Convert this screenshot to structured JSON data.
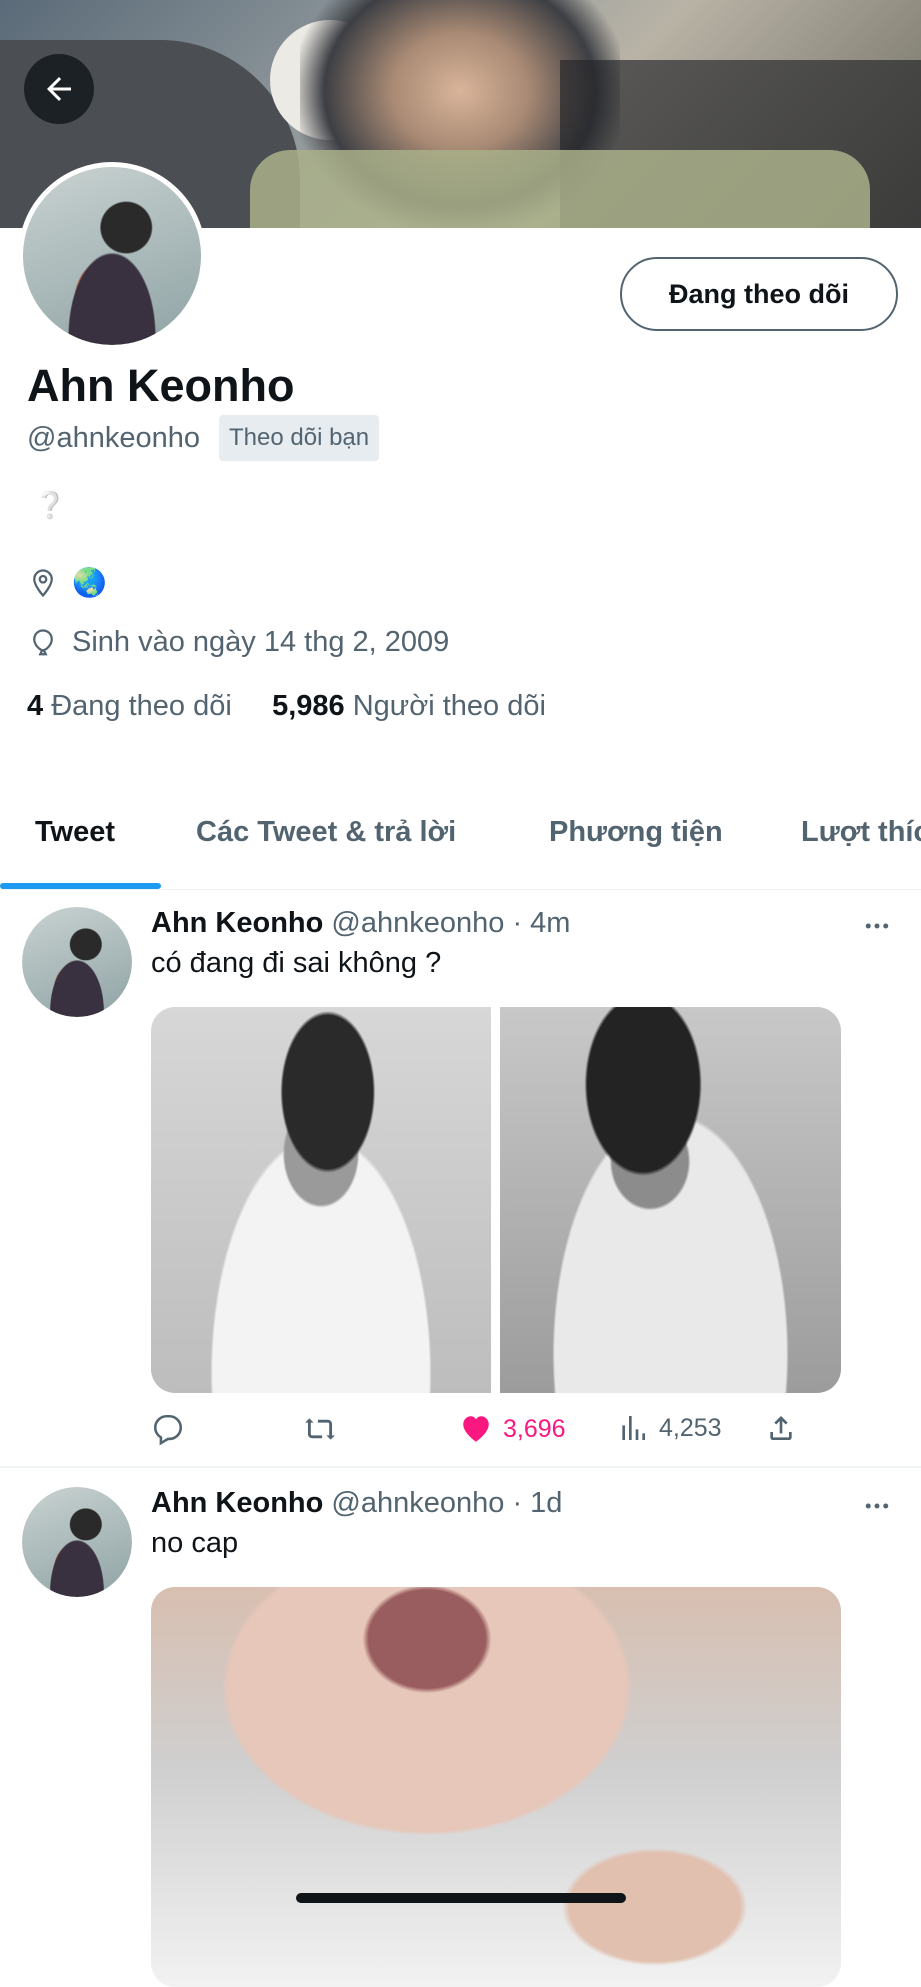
{
  "profile": {
    "follow_button": "Đang theo dõi",
    "name": "Ahn Keonho",
    "handle": "@ahnkeonho",
    "follows_you": "Theo dõi bạn",
    "bio": "❔",
    "location_emoji": "🌏",
    "birthday": "Sinh vào ngày 14 thg 2, 2009",
    "following_count": "4",
    "following_label": "Đang theo dõi",
    "followers_count": "5,986",
    "followers_label": "Người theo dõi"
  },
  "tabs": [
    {
      "label": "Tweet"
    },
    {
      "label": "Các Tweet & trả lời"
    },
    {
      "label": "Phương tiện"
    },
    {
      "label": "Lượt thích"
    }
  ],
  "tweets": [
    {
      "name": "Ahn Keonho",
      "meta": "@ahnkeonho · 4m",
      "text": "có đang đi sai không ?",
      "likes": "3,696",
      "views": "4,253"
    },
    {
      "name": "Ahn Keonho",
      "meta": "@ahnkeonho · 1d",
      "text": "no cap"
    }
  ],
  "icons": {
    "back": "arrow-left-icon",
    "location": "location-pin-icon",
    "birthday": "balloon-icon",
    "more": "more-horizontal-icon",
    "reply": "reply-icon",
    "retweet": "retweet-icon",
    "like": "heart-icon",
    "views": "analytics-icon",
    "share": "share-icon"
  },
  "colors": {
    "accent": "#1d9bf0",
    "like": "#f91880",
    "secondary_text": "#536471"
  }
}
